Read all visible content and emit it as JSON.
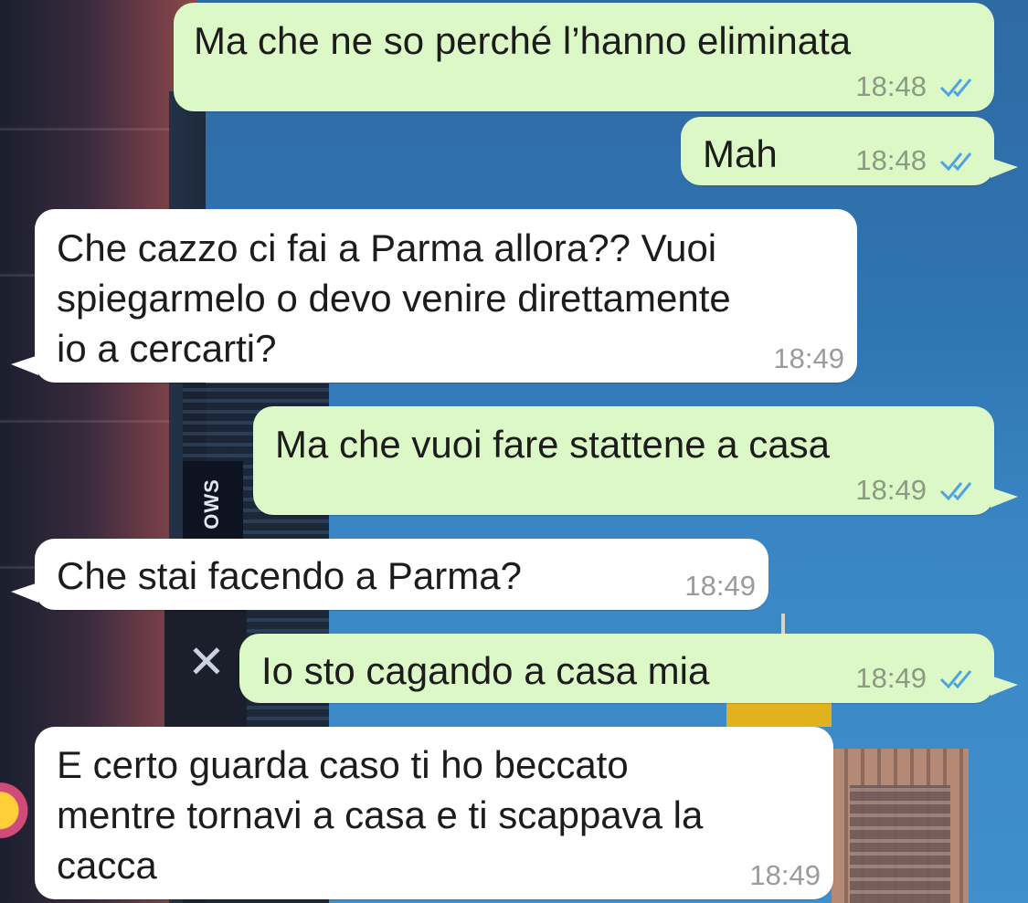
{
  "messages": [
    {
      "text": "Ma che ne so perché l’hanno eliminata",
      "time": "18:48",
      "direction": "outgoing",
      "status": "read"
    },
    {
      "text": "Mah",
      "time": "18:48",
      "direction": "outgoing",
      "status": "read"
    },
    {
      "text": "Che cazzo ci fai a Parma allora?? Vuoi\nspiegarmelo o devo venire direttamente\nio a cercarti?",
      "time": "18:49",
      "direction": "incoming"
    },
    {
      "text": "Ma che vuoi fare stattene a casa",
      "time": "18:49",
      "direction": "outgoing",
      "status": "read"
    },
    {
      "text": "Che stai facendo a Parma?",
      "time": "18:49",
      "direction": "incoming"
    },
    {
      "text": "Io sto cagando a casa mia",
      "time": "18:49",
      "direction": "outgoing",
      "status": "read"
    },
    {
      "text": "E certo guarda caso ti ho beccato\nmentre tornavi a casa e ti scappava la\ncacca",
      "time": "18:49",
      "direction": "incoming"
    }
  ],
  "wallpaper": {
    "sign_text": "OWS"
  },
  "colors": {
    "outgoing_bubble": "#dcf8c6",
    "incoming_bubble": "#ffffff",
    "read_ticks": "#4fa3e0",
    "timestamp_out": "#8b9a82",
    "timestamp_in": "#9b9b9b"
  },
  "icons": {
    "read_receipt": "double-check-icon"
  }
}
